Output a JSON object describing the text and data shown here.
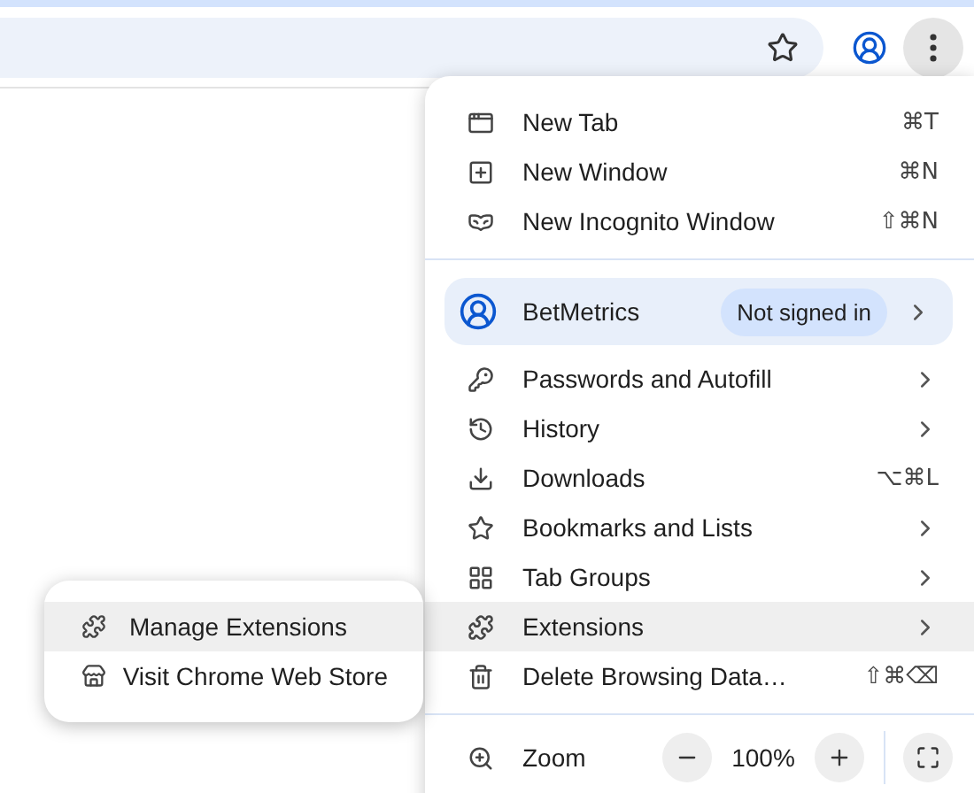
{
  "toolbar": {
    "bookmark_starred": false
  },
  "menu": {
    "top_items": [
      {
        "label": "New Tab",
        "kind": "shortcut",
        "shortcut": "⌘T",
        "selected": false
      },
      {
        "label": "New Window",
        "kind": "shortcut",
        "shortcut": "⌘N",
        "selected": false
      },
      {
        "label": "New Incognito Window",
        "kind": "shortcut",
        "shortcut": "⇧⌘N",
        "selected": false
      }
    ],
    "profile": {
      "name": "BetMetrics",
      "status": "Not signed in"
    },
    "items": [
      {
        "label": "Passwords and Autofill",
        "kind": "submenu",
        "selected": false
      },
      {
        "label": "History",
        "kind": "submenu",
        "selected": false
      },
      {
        "label": "Downloads",
        "kind": "shortcut",
        "shortcut": "⌥⌘L",
        "selected": false
      },
      {
        "label": "Bookmarks and Lists",
        "kind": "submenu",
        "selected": false
      },
      {
        "label": "Tab Groups",
        "kind": "submenu",
        "selected": false
      },
      {
        "label": "Extensions",
        "kind": "submenu",
        "selected": true
      },
      {
        "label": "Delete Browsing Data…",
        "kind": "shortcut",
        "shortcut": "⇧⌘⌫",
        "selected": false
      }
    ],
    "zoom": {
      "label": "Zoom",
      "value": "100%"
    }
  },
  "submenu": {
    "items": [
      {
        "label": "Manage Extensions",
        "selected": true
      },
      {
        "label": "Visit Chrome Web Store",
        "selected": false
      }
    ]
  }
}
